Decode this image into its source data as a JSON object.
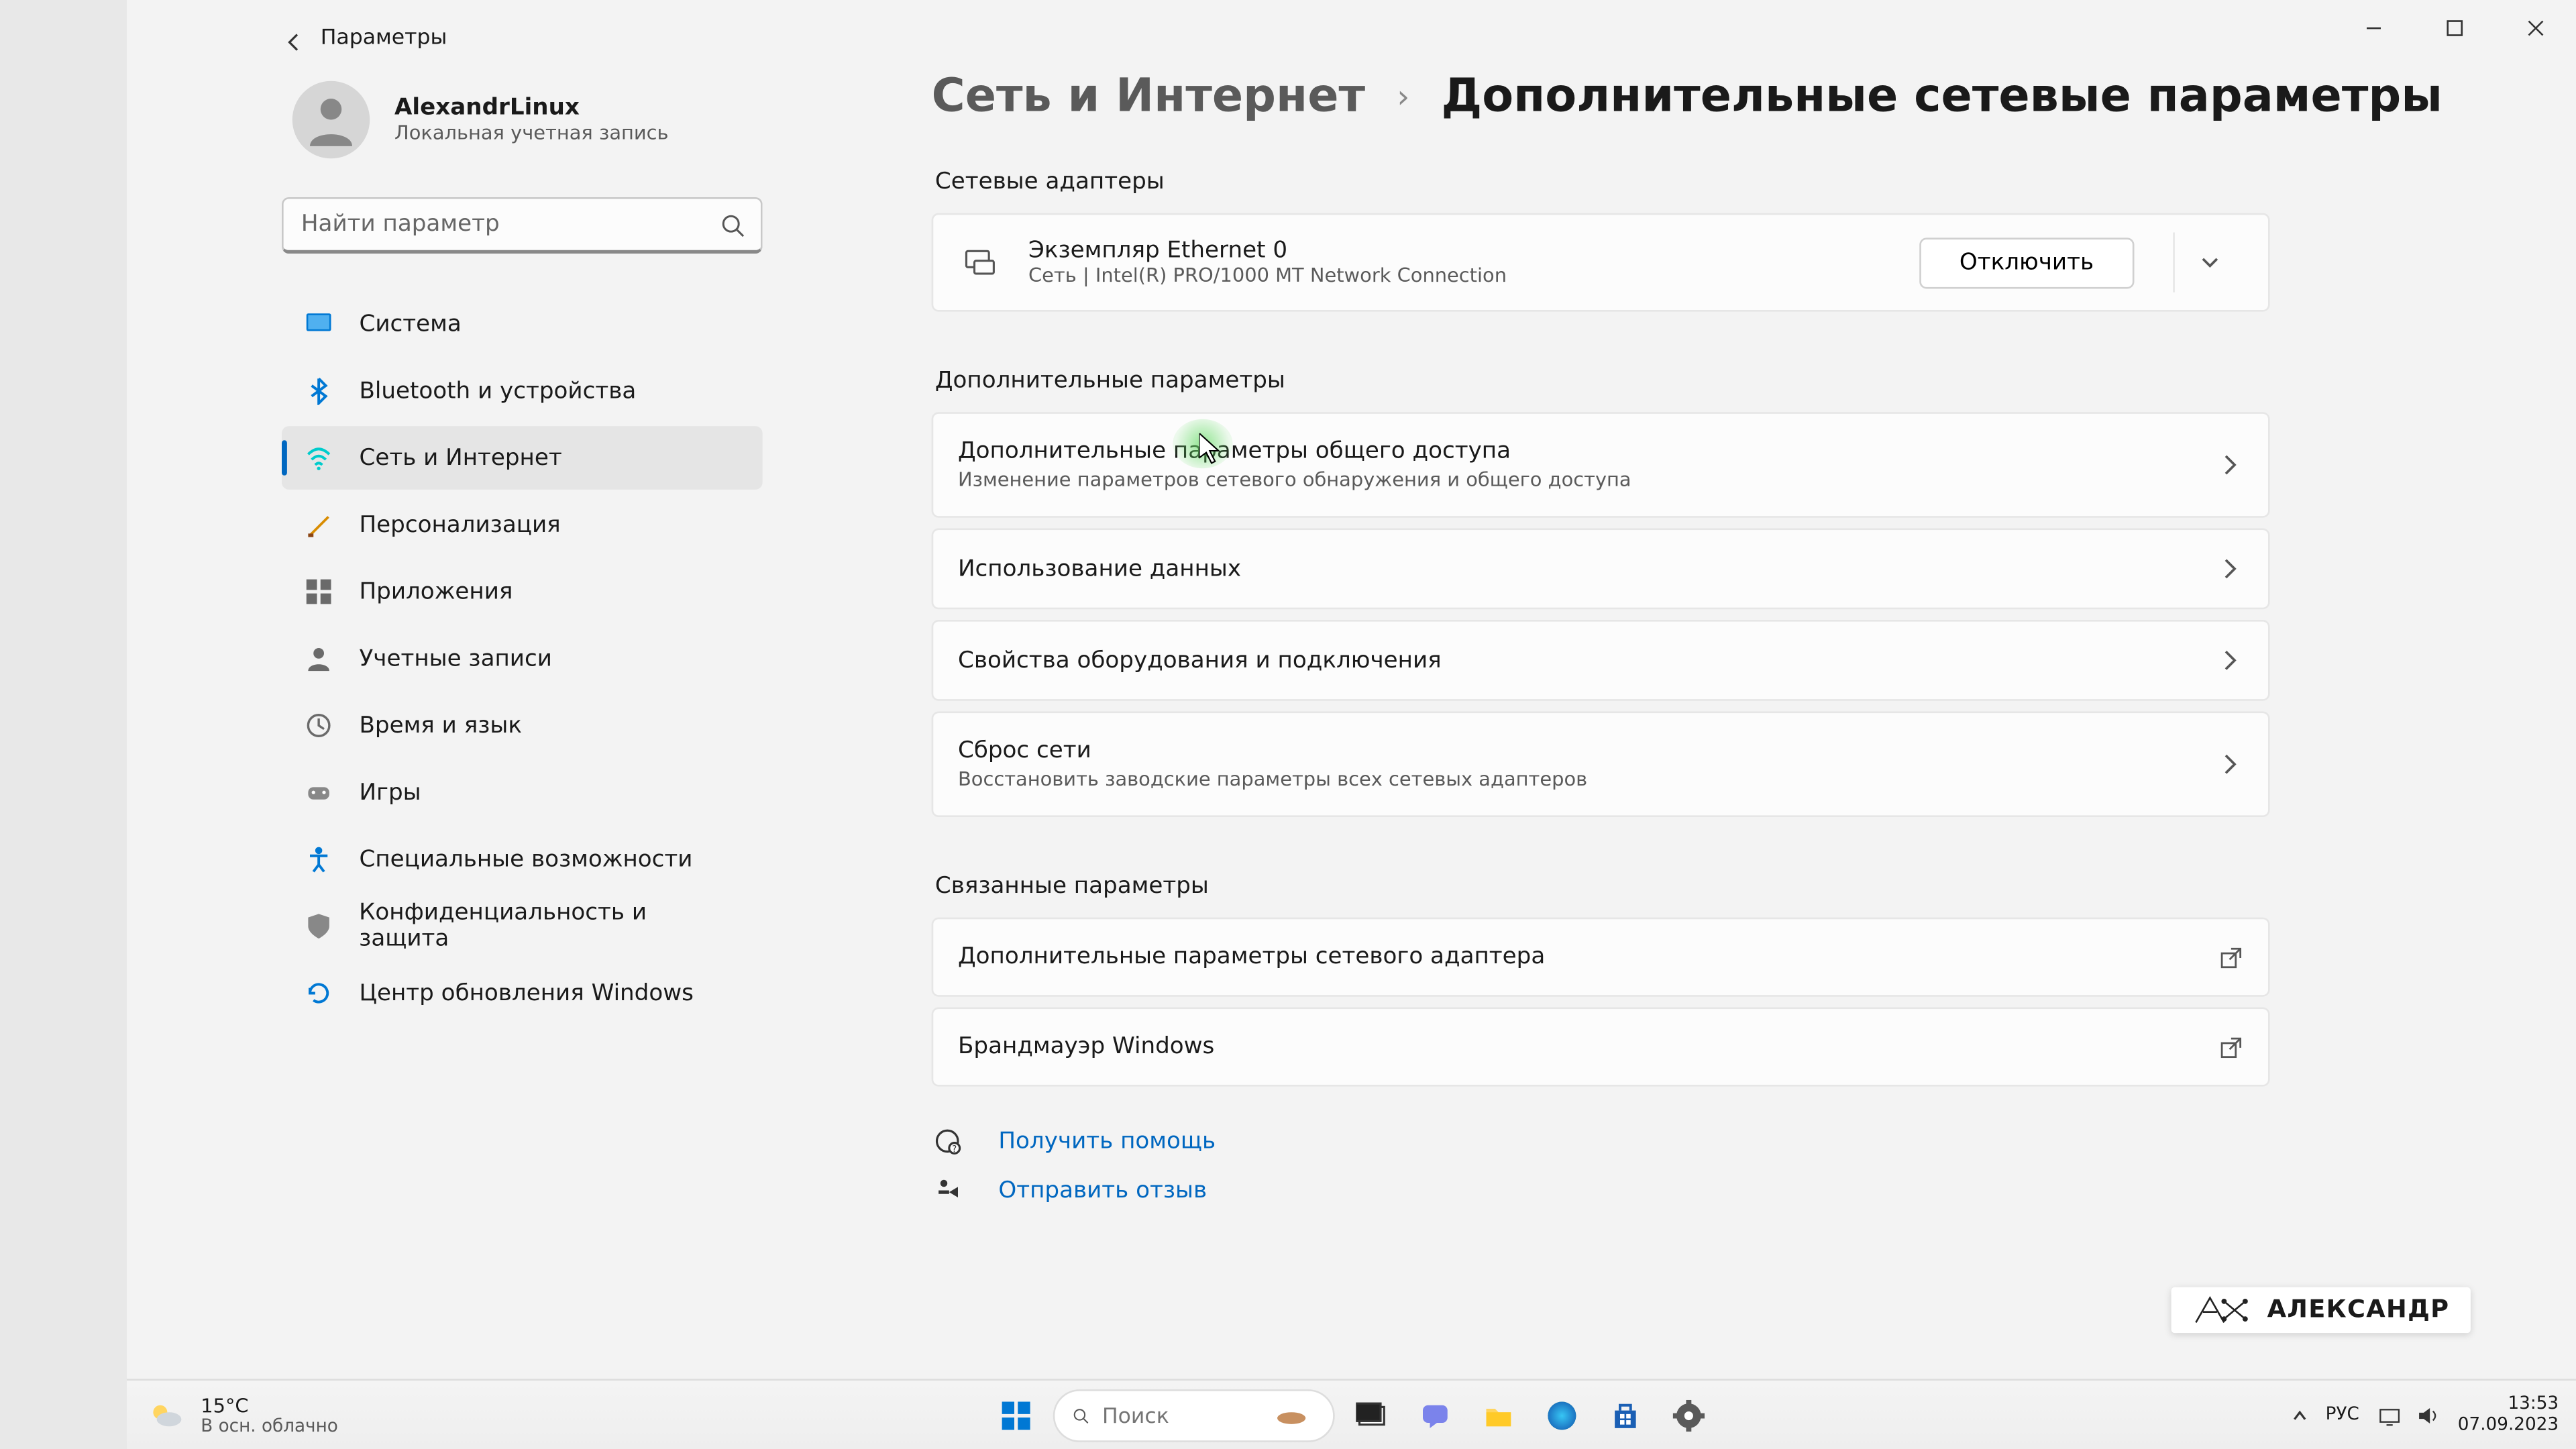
{
  "window": {
    "title": "Параметры"
  },
  "user": {
    "name": "AlexandrLinux",
    "subtitle": "Локальная учетная запись"
  },
  "search": {
    "placeholder": "Найти параметр"
  },
  "nav": {
    "items": [
      {
        "label": "Система",
        "icon": "system"
      },
      {
        "label": "Bluetooth и устройства",
        "icon": "bluetooth"
      },
      {
        "label": "Сеть и Интернет",
        "icon": "network",
        "active": true
      },
      {
        "label": "Персонализация",
        "icon": "personalization"
      },
      {
        "label": "Приложения",
        "icon": "apps"
      },
      {
        "label": "Учетные записи",
        "icon": "accounts"
      },
      {
        "label": "Время и язык",
        "icon": "time"
      },
      {
        "label": "Игры",
        "icon": "gaming"
      },
      {
        "label": "Специальные возможности",
        "icon": "accessibility"
      },
      {
        "label": "Конфиденциальность и защита",
        "icon": "privacy"
      },
      {
        "label": "Центр обновления Windows",
        "icon": "update"
      }
    ]
  },
  "breadcrumb": {
    "parent": "Сеть и Интернет",
    "current": "Дополнительные сетевые параметры"
  },
  "sections": {
    "adapters": {
      "title": "Сетевые адаптеры",
      "items": [
        {
          "name": "Экземпляр Ethernet 0",
          "desc": "Сеть | Intel(R) PRO/1000 MT Network Connection",
          "action": "Отключить"
        }
      ]
    },
    "advanced": {
      "title": "Дополнительные параметры",
      "items": [
        {
          "title": "Дополнительные параметры общего доступа",
          "desc": "Изменение параметров сетевого обнаружения и общего доступа"
        },
        {
          "title": "Использование данных"
        },
        {
          "title": "Свойства оборудования и подключения"
        },
        {
          "title": "Сброс сети",
          "desc": "Восстановить заводские параметры всех сетевых адаптеров"
        }
      ]
    },
    "related": {
      "title": "Связанные параметры",
      "items": [
        {
          "title": "Дополнительные параметры сетевого адаптера",
          "external": true
        },
        {
          "title": "Брандмауэр Windows",
          "external": true
        }
      ]
    }
  },
  "help": {
    "get_help": "Получить помощь",
    "feedback": "Отправить отзыв"
  },
  "watermark": {
    "text": "АЛЕКСАНДР"
  },
  "taskbar": {
    "weather": {
      "temp": "15°C",
      "desc": "В осн. облачно"
    },
    "search_placeholder": "Поиск",
    "lang": "РУС",
    "time": "13:53",
    "date": "07.09.2023"
  }
}
